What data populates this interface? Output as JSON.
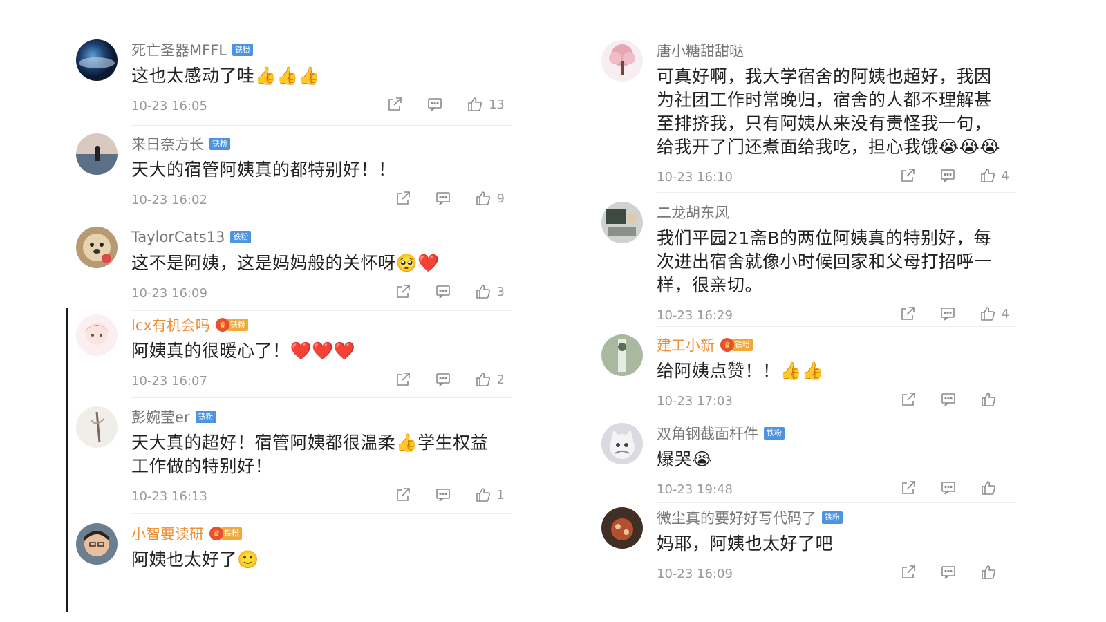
{
  "left": [
    {
      "name": "死亡圣器MFFL",
      "vip": false,
      "badge": "铁粉",
      "text": "这也太感动了哇👍👍👍",
      "time": "10-23 16:05",
      "likes": "13",
      "avatar": "earth"
    },
    {
      "name": "来日奈方长",
      "vip": false,
      "badge": "铁粉",
      "text": "天大的宿管阿姨真的都特别好！！",
      "time": "10-23 16:02",
      "likes": "9",
      "avatar": "sunset"
    },
    {
      "name": "TaylorCats13",
      "vip": false,
      "badge": "铁粉",
      "text": "这不是阿姨，这是妈妈般的关怀呀🥺❤️",
      "time": "10-23 16:09",
      "likes": "3",
      "avatar": "dog"
    },
    {
      "name": "lcx有机会吗",
      "vip": true,
      "badge": "铁粉",
      "text": "阿姨真的很暖心了！❤️❤️❤️",
      "time": "10-23 16:07",
      "likes": "2",
      "avatar": "anime"
    },
    {
      "name": "彭婉莹er",
      "vip": false,
      "badge": "铁粉",
      "text": "天大真的超好！宿管阿姨都很温柔👍学生权益工作做的特别好！",
      "time": "10-23 16:13",
      "likes": "1",
      "avatar": "ink"
    },
    {
      "name": "小智要读研",
      "vip": true,
      "badge": "铁粉",
      "text": "阿姨也太好了🙂",
      "time": "",
      "likes": "",
      "avatar": "boy"
    }
  ],
  "right": [
    {
      "name": "唐小糖甜甜哒",
      "vip": false,
      "badge": "",
      "text": "可真好啊，我大学宿舍的阿姨也超好，我因为社团工作时常晚归，宿舍的人都不理解甚至排挤我，只有阿姨从来没有责怪我一句，给我开了门还煮面给我吃，担心我饿😭😭😭",
      "time": "10-23 16:10",
      "likes": "4",
      "avatar": "tree"
    },
    {
      "name": "二龙胡东风",
      "vip": false,
      "badge": "",
      "text": "我们平园21斋B的两位阿姨真的特别好，每次进出宿舍就像小时候回家和父母打招呼一样，很亲切。",
      "time": "10-23 16:29",
      "likes": "4",
      "avatar": "room"
    },
    {
      "name": "建工小新",
      "vip": true,
      "badge": "铁粉",
      "text": "给阿姨点赞！！👍👍",
      "time": "10-23 17:03",
      "likes": "",
      "avatar": "green"
    },
    {
      "name": "双角钢截面杆件",
      "vip": false,
      "badge": "铁粉",
      "text": "爆哭😭",
      "time": "10-23 19:48",
      "likes": "",
      "avatar": "cat"
    },
    {
      "name": "微尘真的要好好写代码了",
      "vip": false,
      "badge": "铁粉",
      "text": "妈耶，阿姨也太好了吧",
      "time": "10-23 16:09",
      "likes": "",
      "avatar": "food"
    }
  ]
}
